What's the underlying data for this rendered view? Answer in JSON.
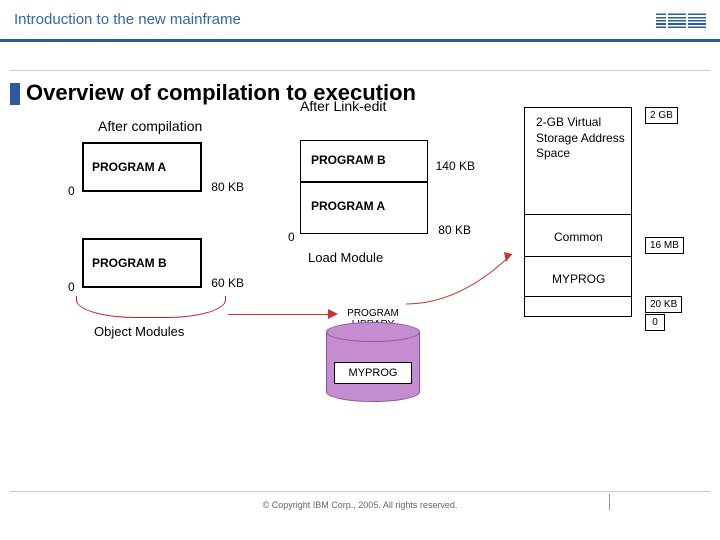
{
  "header": {
    "title": "Introduction to the new mainframe",
    "logo_alt": "IBM"
  },
  "slide": {
    "title": "Overview of compilation to execution"
  },
  "after_compilation": {
    "heading": "After compilation",
    "programA": {
      "name": "PROGRAM A",
      "size": "80 KB",
      "origin": "0"
    },
    "programB": {
      "name": "PROGRAM B",
      "size": "60 KB",
      "origin": "0"
    },
    "group_label": "Object Modules"
  },
  "after_linkedit": {
    "heading": "After Link-edit",
    "programB": {
      "name": "PROGRAM B",
      "size": "140 KB"
    },
    "programA": {
      "name": "PROGRAM A",
      "size": "80 KB",
      "origin": "0"
    },
    "group_label": "Load Module",
    "library_label": "PROGRAM LIBRARY",
    "library_member": "MYPROG"
  },
  "address_space": {
    "description": "2-GB Virtual Storage Address Space",
    "common_label": "Common",
    "myprog_label": "MYPROG",
    "marks": {
      "top": "2 GB",
      "common": "16 MB",
      "myprog": "20 KB",
      "bottom": "0"
    }
  },
  "footer": {
    "copyright": "© Copyright IBM Corp., 2005. All rights reserved."
  }
}
